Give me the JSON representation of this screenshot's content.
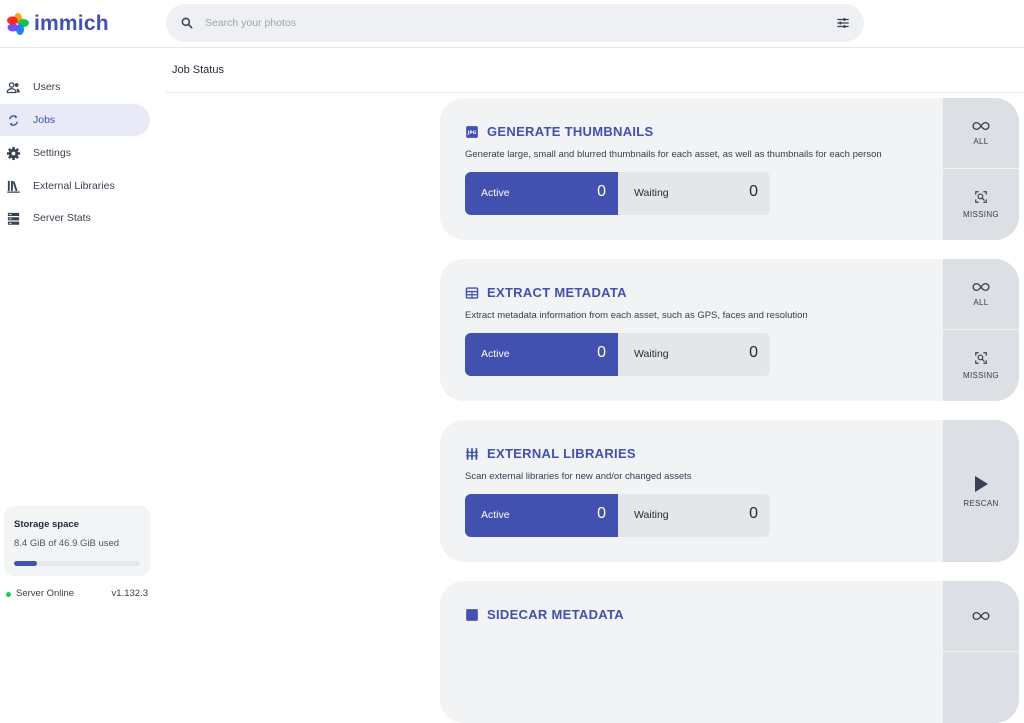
{
  "app": {
    "name": "immich"
  },
  "search": {
    "placeholder": "Search your photos"
  },
  "sidebar": {
    "items": [
      {
        "label": "Users",
        "icon": "users-icon"
      },
      {
        "label": "Jobs",
        "icon": "sync-icon",
        "active": true
      },
      {
        "label": "Settings",
        "icon": "gear-icon"
      },
      {
        "label": "External Libraries",
        "icon": "library-icon"
      },
      {
        "label": "Server Stats",
        "icon": "server-icon"
      }
    ]
  },
  "storage": {
    "title": "Storage space",
    "used_text": "8.4 GiB of 46.9 GiB used",
    "used_fraction": 0.179
  },
  "server": {
    "status": "Server Online",
    "version": "v1.132.3"
  },
  "page": {
    "title": "Job Status"
  },
  "jobs": [
    {
      "title": "GENERATE THUMBNAILS",
      "description": "Generate large, small and blurred thumbnails for each asset, as well as thumbnails for each person",
      "active_label": "Active",
      "active_count": "0",
      "waiting_label": "Waiting",
      "waiting_count": "0",
      "actions": [
        "ALL",
        "MISSING"
      ]
    },
    {
      "title": "EXTRACT METADATA",
      "description": "Extract metadata information from each asset, such as GPS, faces and resolution",
      "active_label": "Active",
      "active_count": "0",
      "waiting_label": "Waiting",
      "waiting_count": "0",
      "actions": [
        "ALL",
        "MISSING"
      ]
    },
    {
      "title": "EXTERNAL LIBRARIES",
      "description": "Scan external libraries for new and/or changed assets",
      "active_label": "Active",
      "active_count": "0",
      "waiting_label": "Waiting",
      "waiting_count": "0",
      "actions": [
        "RESCAN"
      ]
    },
    {
      "title": "SIDECAR METADATA"
    }
  ],
  "colors": {
    "accent": "#4250af",
    "card_bg": "#f1f3f4",
    "action_bg": "#dcdfe3",
    "online": "#22c55e"
  }
}
